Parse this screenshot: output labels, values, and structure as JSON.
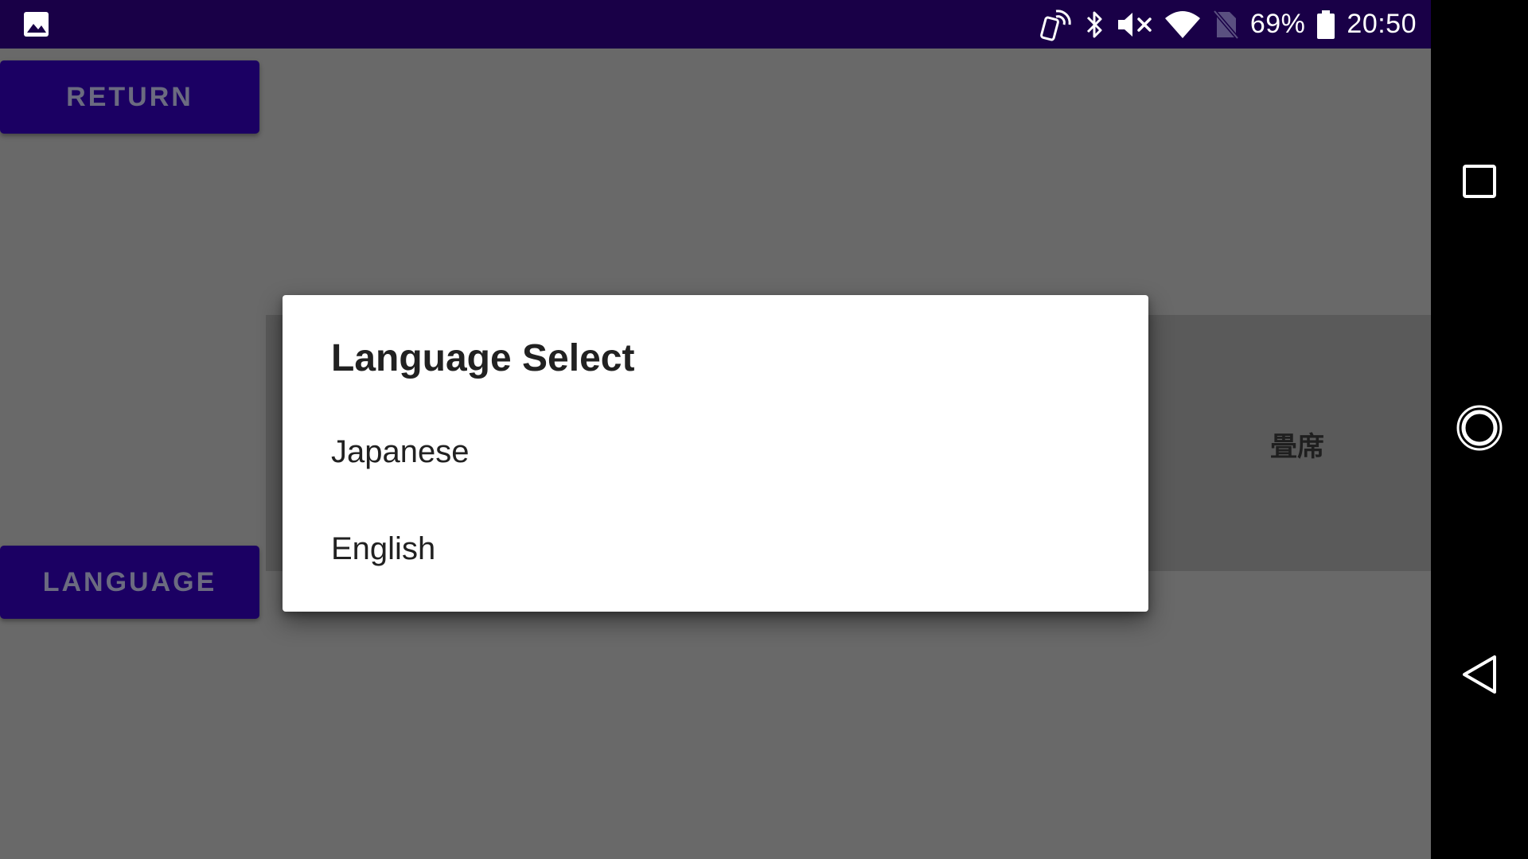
{
  "status_bar": {
    "battery_percent": "69%",
    "time": "20:50",
    "icons": [
      "gallery-icon",
      "nfc-icon",
      "bluetooth-icon",
      "volume-muted-icon",
      "wifi-icon",
      "no-sim-icon",
      "battery-icon"
    ]
  },
  "app": {
    "return_label": "RETURN",
    "language_label": "LANGUAGE",
    "panel_label": "畳席"
  },
  "dialog": {
    "title": "Language Select",
    "options": [
      {
        "label": "Japanese"
      },
      {
        "label": "English"
      }
    ]
  },
  "nav_bar": {
    "icons": [
      "recents-icon",
      "home-icon",
      "back-icon"
    ]
  },
  "colors": {
    "status_bar_bg": "#190047",
    "button_bg": "#1b0063",
    "scrim": "#696969",
    "dialog_bg": "#ffffff",
    "nav_bar_bg": "#000000"
  }
}
